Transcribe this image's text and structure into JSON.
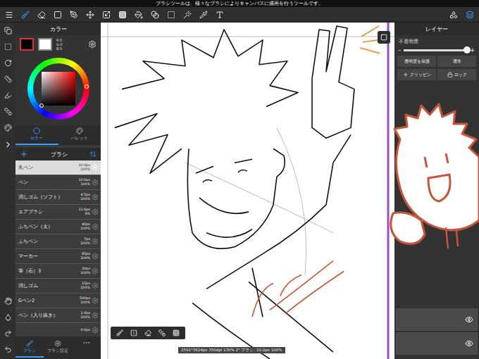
{
  "hint": "ブラシツールは、様々なブラシによりキャンバスに描画を行うツールです。",
  "toolbar": {
    "tools": [
      {
        "selected": false
      },
      {
        "selected": true
      },
      {
        "selected": false
      },
      {
        "selected": false
      },
      {
        "selected": false
      },
      {
        "selected": false
      },
      {
        "selected": false
      },
      {
        "selected": false
      },
      {
        "selected": false
      },
      {
        "selected": false
      },
      {
        "selected": false
      },
      {
        "selected": false
      },
      {
        "selected": false
      },
      {
        "selected": false
      }
    ],
    "right_tools": [
      {
        "selected": false
      },
      {
        "selected": true
      }
    ]
  },
  "color_panel": {
    "title": "カラー",
    "rgb": [
      "R:0",
      "G:0",
      "B:0"
    ],
    "tabs": [
      {
        "label": "カラー",
        "selected": true
      },
      {
        "label": "パレット",
        "selected": false
      }
    ]
  },
  "brush_panel": {
    "title": "ブラシ",
    "items": [
      {
        "name": "丸ペン",
        "size": "10.0px",
        "opacity": "100%",
        "selected": true
      },
      {
        "name": "ペン",
        "size": "10.0px",
        "opacity": "100%",
        "selected": false
      },
      {
        "name": "消しゴム（ソフト）",
        "size": "4.5px",
        "opacity": "100%",
        "selected": false
      },
      {
        "name": "エアブラシ",
        "size": "11.6px",
        "opacity": "9%",
        "selected": false
      },
      {
        "name": "ふちペン（太）",
        "size": "40px",
        "opacity": "100%",
        "selected": false
      },
      {
        "name": "ふちペン",
        "size": "7px",
        "opacity": "100%",
        "selected": false
      },
      {
        "name": "マーカー",
        "size": "45px",
        "opacity": "100%",
        "selected": false
      },
      {
        "name": "筆（石）3",
        "size": "30px",
        "opacity": "100%",
        "selected": false
      },
      {
        "name": "消しゴム",
        "size": "15px",
        "opacity": "100%",
        "selected": false
      },
      {
        "name": "Gペン2",
        "size": "500px",
        "opacity": "100%",
        "selected": false
      },
      {
        "name": "ペン（入り抜き）",
        "size": "1.0px",
        "opacity": "100%",
        "selected": false
      },
      {
        "name": "",
        "size": "9.0px",
        "opacity": "",
        "selected": false
      }
    ],
    "tabs": [
      {
        "label": "ブラシ",
        "selected": true
      },
      {
        "label": "ブラシ設定",
        "selected": false
      },
      {
        "label": "•••",
        "selected": false
      }
    ]
  },
  "layer_panel": {
    "title": "レイヤー",
    "opacity_label": "不透明度",
    "minus": "-",
    "plus": "+",
    "opacity": {
      "level": 1
    },
    "protect": "透明度を保護",
    "blend": "通常",
    "clipping": "クリッピン",
    "lock": "ロック",
    "layers": [
      {
        "visible": true
      },
      {
        "visible": true
      }
    ]
  },
  "canvas": {
    "status": "2591*3624px 350dpi 130% 2° ブラシ: 10.0px 100%"
  }
}
